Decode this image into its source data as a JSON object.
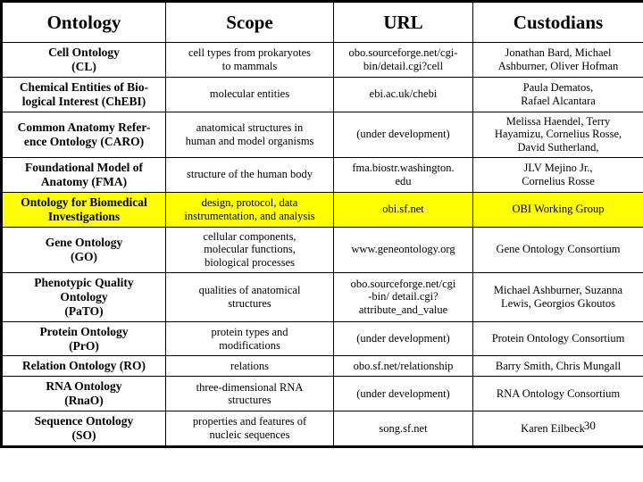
{
  "table": {
    "name": "ontology-overview-table",
    "highlight_color": "#ffff00",
    "border_color": "#000000",
    "columns": [
      {
        "key": "ontology",
        "label": "Ontology"
      },
      {
        "key": "scope",
        "label": "Scope"
      },
      {
        "key": "url",
        "label": "URL"
      },
      {
        "key": "custodians",
        "label": "Custodians"
      }
    ],
    "rows": [
      {
        "highlight": false,
        "ontology": [
          "Cell Ontology",
          "(CL)"
        ],
        "scope": [
          "cell types from prokaryotes",
          "to mammals"
        ],
        "url": [
          "obo.sourceforge.net/cgi-",
          "bin/detail.cgi?cell"
        ],
        "custodians": [
          "Jonathan Bard, Michael",
          "Ashburner, Oliver Hofman"
        ]
      },
      {
        "highlight": false,
        "ontology": [
          "Chemical Entities of Bio-",
          "logical Interest (ChEBI)"
        ],
        "scope": [
          "molecular entities"
        ],
        "url": [
          "ebi.ac.uk/chebi"
        ],
        "custodians": [
          "Paula Dematos,",
          "Rafael Alcantara"
        ]
      },
      {
        "highlight": false,
        "ontology": [
          "Common Anatomy Refer-",
          "ence Ontology (CARO)"
        ],
        "scope": [
          "anatomical structures in",
          "human and model organisms"
        ],
        "url": [
          "(under development)"
        ],
        "custodians": [
          "Melissa Haendel, Terry",
          "Hayamizu, Cornelius Rosse,",
          "David Sutherland,"
        ]
      },
      {
        "highlight": false,
        "ontology": [
          "Foundational Model of",
          "Anatomy (FMA)"
        ],
        "scope": [
          "structure of the human body"
        ],
        "url": [
          "fma.biostr.washington.",
          "edu"
        ],
        "custodians": [
          "JLV Mejino Jr.,",
          "Cornelius Rosse"
        ]
      },
      {
        "highlight": true,
        "ontology": [
          "Ontology for Biomedical",
          "Investigations"
        ],
        "scope": [
          "design, protocol, data",
          "instrumentation, and analysis"
        ],
        "url": [
          "obi.sf.net"
        ],
        "custodians": [
          "OBI Working Group"
        ]
      },
      {
        "highlight": false,
        "ontology": [
          "Gene Ontology",
          "(GO)"
        ],
        "scope": [
          "cellular components,",
          "molecular functions,",
          "biological processes"
        ],
        "url": [
          "www.geneontology.org"
        ],
        "custodians": [
          "Gene Ontology Consortium"
        ]
      },
      {
        "highlight": false,
        "ontology": [
          "Phenotypic Quality",
          "Ontology",
          "(PaTO)"
        ],
        "scope": [
          "qualities of anatomical",
          "structures"
        ],
        "url": [
          "obo.sourceforge.net/cgi",
          "-bin/ detail.cgi?",
          "attribute_and_value"
        ],
        "custodians": [
          "Michael Ashburner, Suzanna",
          "Lewis, Georgios Gkoutos"
        ]
      },
      {
        "highlight": false,
        "ontology": [
          "Protein Ontology",
          "(PrO)"
        ],
        "scope": [
          "protein types and",
          "modifications"
        ],
        "url": [
          "(under development)"
        ],
        "custodians": [
          "Protein Ontology Consortium"
        ]
      },
      {
        "highlight": false,
        "ontology": [
          "Relation Ontology (RO)"
        ],
        "scope": [
          "relations"
        ],
        "url": [
          "obo.sf.net/relationship"
        ],
        "custodians": [
          "Barry Smith, Chris Mungall"
        ]
      },
      {
        "highlight": false,
        "ontology": [
          "RNA Ontology",
          "(RnaO)"
        ],
        "scope": [
          "three-dimensional RNA",
          "structures"
        ],
        "url": [
          "(under development)"
        ],
        "custodians": [
          "RNA Ontology Consortium"
        ]
      },
      {
        "highlight": false,
        "ontology": [
          "Sequence Ontology",
          "(SO)"
        ],
        "scope": [
          "properties and features of",
          "nucleic sequences"
        ],
        "url": [
          "song.sf.net"
        ],
        "custodians": [
          "Karen Eilbeck"
        ],
        "custodians_ref": "30"
      }
    ]
  }
}
